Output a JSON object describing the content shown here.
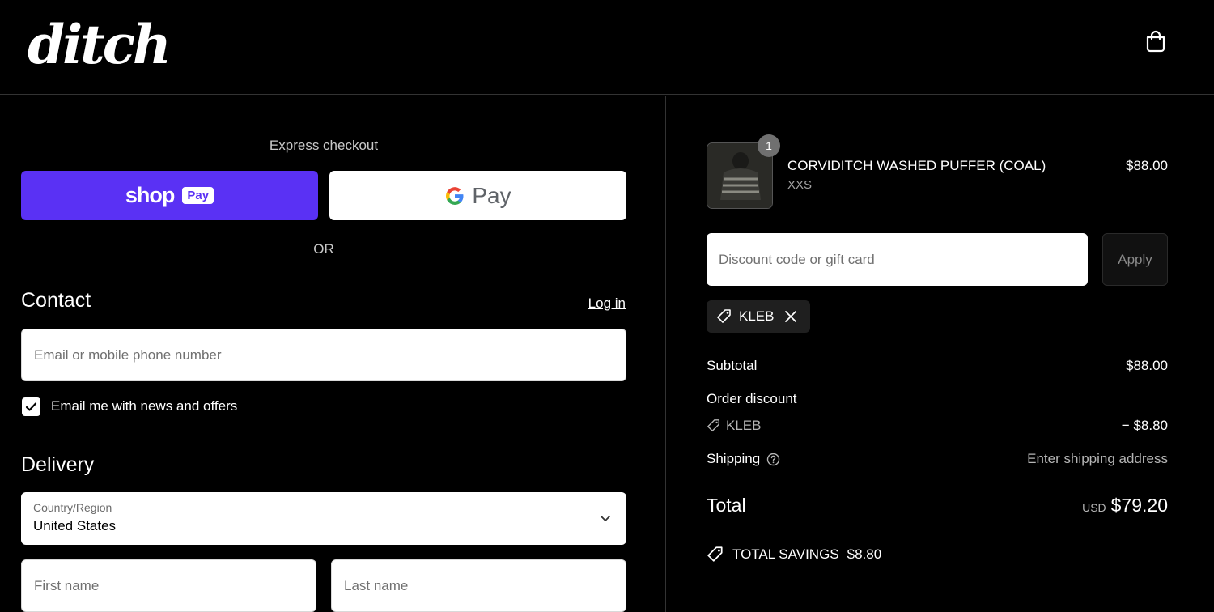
{
  "brand": {
    "logo_text": "ditch"
  },
  "left": {
    "express_title": "Express checkout",
    "shop_pay": {
      "word": "shop",
      "tag": "Pay"
    },
    "gpay": {
      "label": "Pay"
    },
    "or_text": "OR",
    "contact": {
      "title": "Contact",
      "login_label": "Log in",
      "email_placeholder": "Email or mobile phone number",
      "checkbox_label": "Email me with news and offers",
      "checkbox_checked": true
    },
    "delivery": {
      "title": "Delivery",
      "country_label": "Country/Region",
      "country_value": "United States",
      "first_name_placeholder": "First name",
      "last_name_placeholder": "Last name"
    }
  },
  "summary": {
    "item": {
      "quantity": "1",
      "name": "CORVIDITCH WASHED PUFFER (COAL)",
      "variant": "XXS",
      "price": "$88.00"
    },
    "discount": {
      "placeholder": "Discount code or gift card",
      "apply_label": "Apply",
      "applied_code": "KLEB"
    },
    "subtotal_label": "Subtotal",
    "subtotal_value": "$88.00",
    "order_discount_label": "Order discount",
    "order_discount_code": "KLEB",
    "order_discount_value": "− $8.80",
    "shipping_label": "Shipping",
    "shipping_value": "Enter shipping address",
    "total_label": "Total",
    "total_currency": "USD",
    "total_value": "$79.20",
    "savings_label": "TOTAL SAVINGS",
    "savings_value": "$8.80"
  },
  "colors": {
    "shop_pay": "#5a31f4",
    "background": "#000000"
  }
}
